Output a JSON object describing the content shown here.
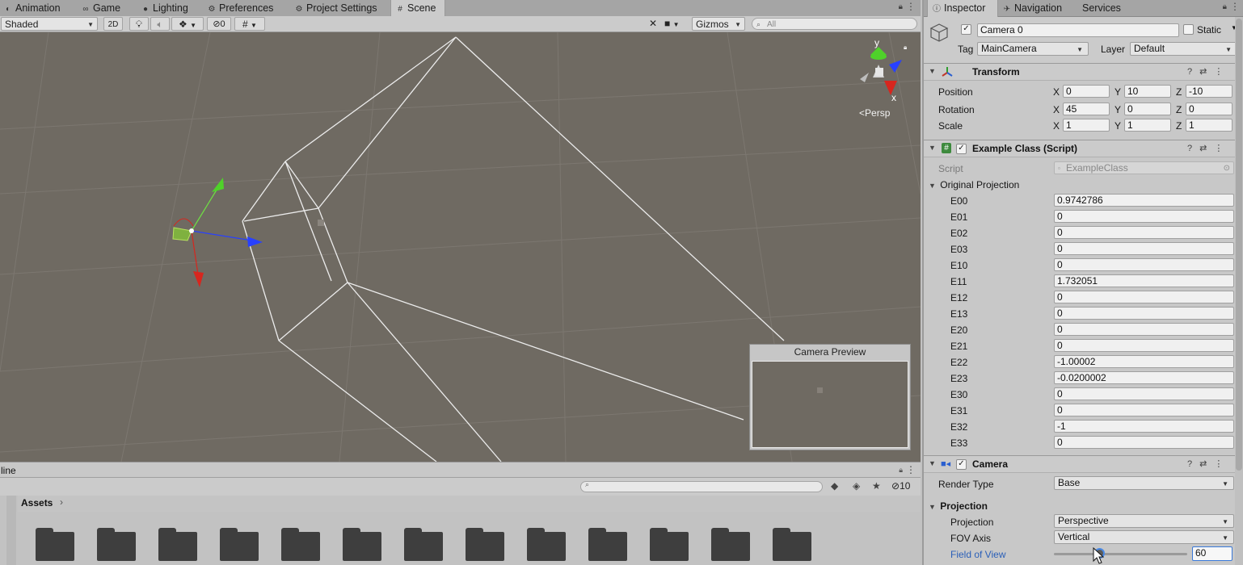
{
  "scene_tabs": [
    {
      "label": "Animation",
      "icon": "animation-icon"
    },
    {
      "label": "Game",
      "icon": "game-icon"
    },
    {
      "label": "Lighting",
      "icon": "lighting-icon"
    },
    {
      "label": "Preferences",
      "icon": "gear-icon"
    },
    {
      "label": "Project Settings",
      "icon": "gear-icon"
    },
    {
      "label": "Scene",
      "icon": "scene-grid-icon"
    }
  ],
  "toolbar": {
    "shading": "Shaded",
    "mode_2d": "2D",
    "hidden_count": "0",
    "gizmos": "Gizmos",
    "search_placeholder": "All"
  },
  "scene": {
    "axis_y": "y",
    "axis_x": "x",
    "persp": "Persp",
    "camera_preview_title": "Camera Preview"
  },
  "project": {
    "console_label": "line",
    "breadcrumb": "Assets",
    "hidden_count": "10",
    "folder_count": 13
  },
  "inspector": {
    "tabs": [
      "Inspector",
      "Navigation",
      "Services"
    ],
    "object_name": "Camera 0",
    "static_label": "Static",
    "tag_label": "Tag",
    "tag_value": "MainCamera",
    "layer_label": "Layer",
    "layer_value": "Default",
    "transform": {
      "title": "Transform",
      "rows": [
        {
          "label": "Position",
          "x": "0",
          "y": "10",
          "z": "-10"
        },
        {
          "label": "Rotation",
          "x": "45",
          "y": "0",
          "z": "0"
        },
        {
          "label": "Scale",
          "x": "1",
          "y": "1",
          "z": "1"
        }
      ]
    },
    "script_component": {
      "title": "Example Class (Script)",
      "script_label": "Script",
      "script_value": "ExampleClass",
      "foldout_label": "Original Projection",
      "elements": [
        {
          "label": "E00",
          "value": "0.9742786"
        },
        {
          "label": "E01",
          "value": "0"
        },
        {
          "label": "E02",
          "value": "0"
        },
        {
          "label": "E03",
          "value": "0"
        },
        {
          "label": "E10",
          "value": "0"
        },
        {
          "label": "E11",
          "value": "1.732051"
        },
        {
          "label": "E12",
          "value": "0"
        },
        {
          "label": "E13",
          "value": "0"
        },
        {
          "label": "E20",
          "value": "0"
        },
        {
          "label": "E21",
          "value": "0"
        },
        {
          "label": "E22",
          "value": "-1.00002"
        },
        {
          "label": "E23",
          "value": "-0.0200002"
        },
        {
          "label": "E30",
          "value": "0"
        },
        {
          "label": "E31",
          "value": "0"
        },
        {
          "label": "E32",
          "value": "-1"
        },
        {
          "label": "E33",
          "value": "0"
        }
      ]
    },
    "camera": {
      "title": "Camera",
      "render_type_label": "Render Type",
      "render_type_value": "Base",
      "projection_section": "Projection",
      "projection_label": "Projection",
      "projection_value": "Perspective",
      "fov_axis_label": "FOV Axis",
      "fov_axis_value": "Vertical",
      "fov_label": "Field of View",
      "fov_value": "60",
      "fov_slider_fraction": 0.34
    }
  },
  "colors": {
    "scene_bg": "#6f6a62",
    "panel_bg": "#c8c8c8",
    "accent_link": "#2a5fb8",
    "axis_x": "#d7261e",
    "axis_y": "#4fd12a",
    "axis_z": "#2840ff"
  }
}
